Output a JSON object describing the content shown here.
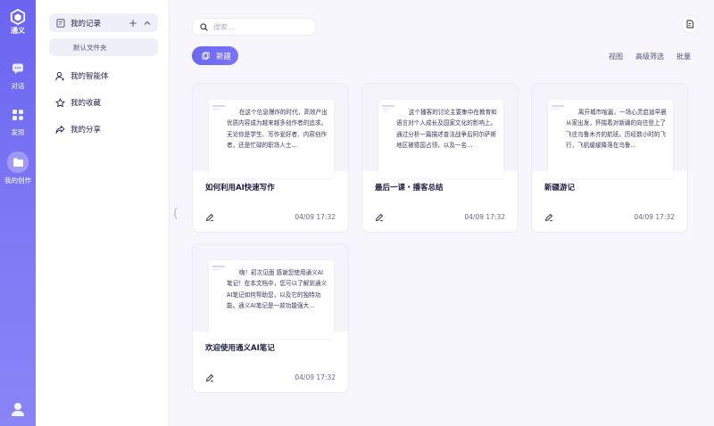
{
  "app": {
    "logo_text": "通义"
  },
  "rail": {
    "items": [
      {
        "label": "对话",
        "icon": "chat-icon"
      },
      {
        "label": "发现",
        "icon": "grid-icon"
      },
      {
        "label": "我的创作",
        "icon": "folder-icon",
        "active": true
      }
    ],
    "avatar_icon": "user-avatar-icon"
  },
  "sidebar": {
    "records_label": "我的记录",
    "default_folder": "默认文件夹",
    "items": [
      {
        "label": "我的智能体",
        "icon": "agent-icon"
      },
      {
        "label": "我的收藏",
        "icon": "star-icon"
      },
      {
        "label": "我的分享",
        "icon": "share-icon"
      }
    ]
  },
  "main": {
    "search": {
      "placeholder": "搜索..."
    },
    "new_label": "新建",
    "toolbar": {
      "view": "视图",
      "filter": "高级筛选",
      "batch": "批量"
    },
    "cards": [
      {
        "excerpt": "在这个信息爆炸的时代，高效产出优质内容成为越来越多创作者的追求。无论你是学生、写作爱好者、内容创作者，还是忙碌的职场人士...",
        "title": "如何利用AI快速写作",
        "date": "04/09 17:32"
      },
      {
        "excerpt": "这个播客的讨论主要集中在教育和语言对个人成长及国家文化的影响上。通过分析一篇描述普法战争后阿尔萨斯地区被德国占领，以及一名...",
        "title": "最后一课・播客总结",
        "date": "04/09 17:32"
      },
      {
        "excerpt": "离开城市喧嚣，一场心灵启迪早晨从家出发，怀揣着对新疆的向往登上了飞往乌鲁木齐的航班。历经数小时的飞行，飞机缓缓降落在乌鲁...",
        "title": "新疆游记",
        "date": "04/09 17:32"
      },
      {
        "excerpt": "嗨！初次见面 感谢您使用通义AI笔记！在本文档中，您可以了解到通义AI笔记如何帮助您，以及它的独特功能。通义AI笔记是一款功能强大...",
        "title": "欢迎使用通义AI笔记",
        "date": "04/09 17:32"
      }
    ]
  },
  "colors": {
    "accent": "#6d66f2",
    "rail_bg": "#7a74f4"
  }
}
